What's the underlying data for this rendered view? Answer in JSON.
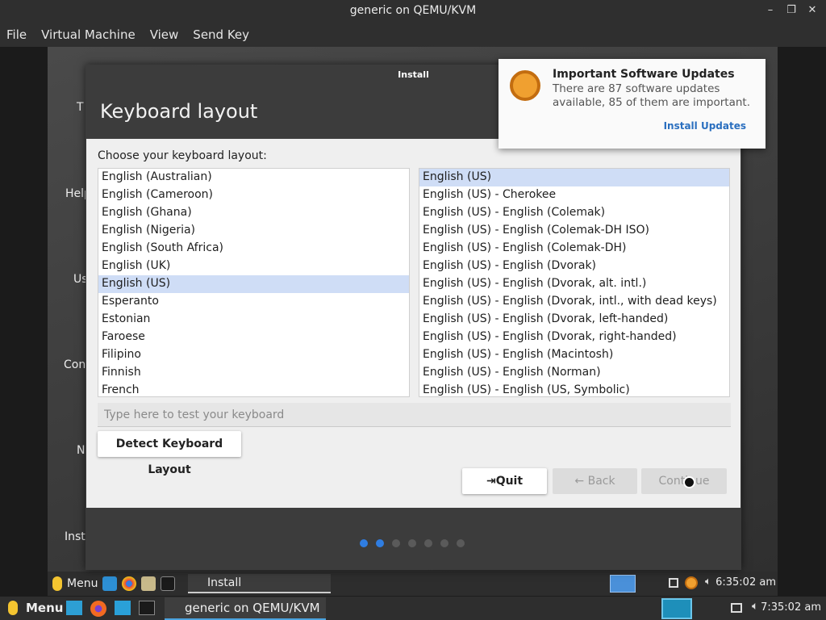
{
  "host": {
    "window_title": "generic on QEMU/KVM",
    "menus": [
      "File",
      "Virtual Machine",
      "View",
      "Send Key"
    ]
  },
  "desktop_labels": [
    "T",
    "Help",
    "Us",
    "Con",
    "N",
    "Insta"
  ],
  "installer": {
    "window_title": "Install",
    "heading": "Keyboard layout",
    "choose_label": "Choose your keyboard layout:",
    "layouts": [
      "English (Australian)",
      "English (Cameroon)",
      "English (Ghana)",
      "English (Nigeria)",
      "English (South Africa)",
      "English (UK)",
      "English (US)",
      "Esperanto",
      "Estonian",
      "Faroese",
      "Filipino",
      "Finnish",
      "French"
    ],
    "selected_layout": "English (US)",
    "variants": [
      "English (US)",
      "English (US) - Cherokee",
      "English (US) - English (Colemak)",
      "English (US) - English (Colemak-DH ISO)",
      "English (US) - English (Colemak-DH)",
      "English (US) - English (Dvorak)",
      "English (US) - English (Dvorak, alt. intl.)",
      "English (US) - English (Dvorak, intl., with dead keys)",
      "English (US) - English (Dvorak, left-handed)",
      "English (US) - English (Dvorak, right-handed)",
      "English (US) - English (Macintosh)",
      "English (US) - English (Norman)",
      "English (US) - English (US, Symbolic)"
    ],
    "selected_variant": "English (US)",
    "test_placeholder": "Type here to test your keyboard",
    "detect_label": "Detect Keyboard Layout",
    "quit_label": "Quit",
    "back_label": "Back",
    "continue_label": "Continue",
    "progress": {
      "total": 7,
      "active": 2
    }
  },
  "notification": {
    "title": "Important Software Updates",
    "body": "There are 87 software updates available, 85 of them are important.",
    "action": "Install Updates"
  },
  "guest_panel": {
    "menu_label": "Menu",
    "task_label": "Install",
    "clock": "6:35:02 am"
  },
  "host_panel": {
    "menu_label": "Menu",
    "task_label": "generic on QEMU/KVM",
    "clock": "7:35:02 am"
  },
  "colors": {
    "selection": "#cfddf6",
    "accent": "#2f7de1"
  }
}
